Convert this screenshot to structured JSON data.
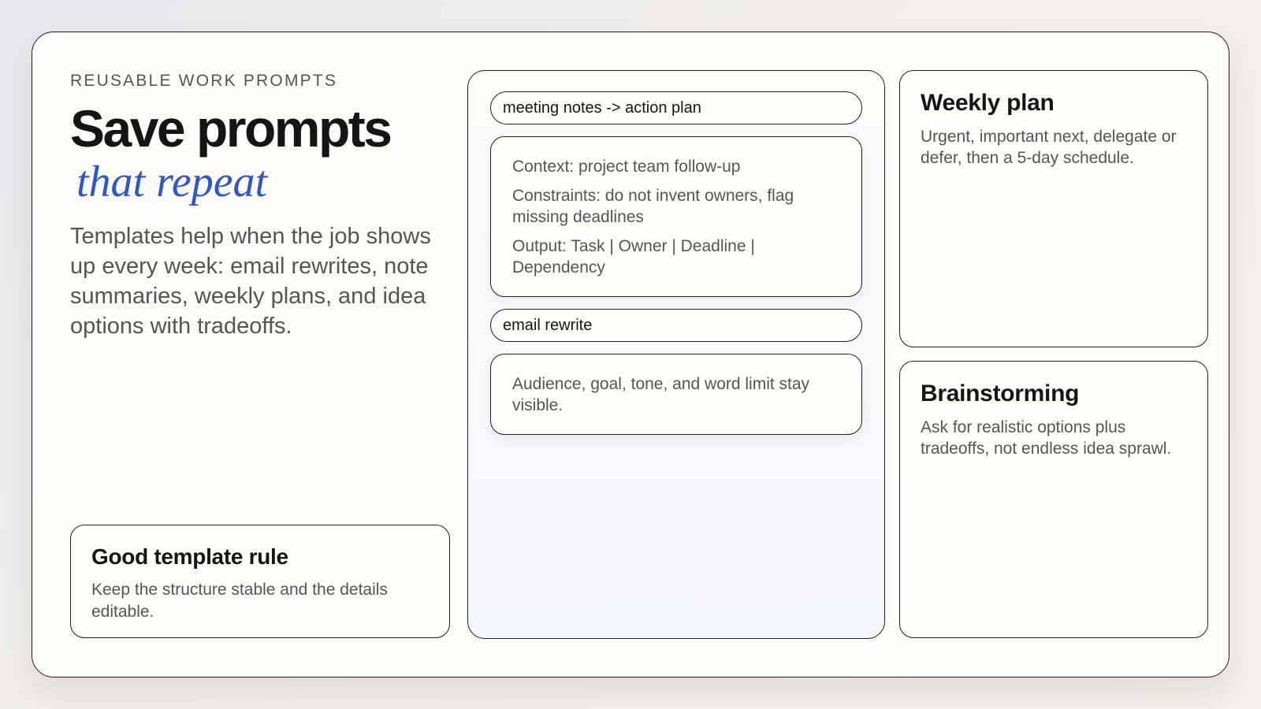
{
  "left": {
    "eyebrow": "REUSABLE WORK PROMPTS",
    "title": "Save prompts",
    "title_accent": "that repeat",
    "lead": "Templates help when the job shows up every week: email rewrites, note summaries, weekly plans, and idea options with tradeoffs.",
    "rule_card": {
      "title": "Good template rule",
      "body": "Keep the structure stable and the details editable."
    }
  },
  "middle": {
    "template1": {
      "label": "meeting notes -> action plan",
      "lines": [
        "Context: project team follow-up",
        "Constraints: do not invent owners, flag missing deadlines",
        "Output: Task | Owner | Deadline | Dependency"
      ]
    },
    "template2": {
      "label": "email rewrite",
      "lines": [
        "Audience, goal, tone, and word limit stay visible."
      ]
    }
  },
  "right": {
    "weekly": {
      "title": "Weekly plan",
      "body": "Urgent, important next, delegate or defer, then a 5-day schedule."
    },
    "brainstorm": {
      "title": "Brainstorming",
      "body": "Ask for realistic options plus tradeoffs, not endless idea sprawl."
    }
  },
  "colors": {
    "accent": "#2f57c6",
    "ink": "#151515",
    "muted": "#555555",
    "paper": "#fdfbf7"
  }
}
